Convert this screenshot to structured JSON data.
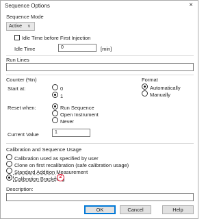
{
  "dialog": {
    "title": "Sequence Options",
    "close_glyph": "×"
  },
  "sequence_mode": {
    "heading": "Sequence Mode",
    "selected": "Active",
    "idle_checkbox_label": "Idle Time before First Injection",
    "idle_time_label": "Idle Time",
    "idle_time_value": "0",
    "idle_time_unit": "[min]"
  },
  "run_lines": {
    "heading": "Run Lines",
    "value": ""
  },
  "counter": {
    "heading": "Counter (%n)",
    "start_label": "Start at:",
    "start_options": [
      "0",
      "1"
    ],
    "start_selected": "1",
    "reset_label": "Reset when:",
    "reset_options": [
      "Run Sequence",
      "Open Instrument",
      "Never"
    ],
    "reset_selected": "Run Sequence",
    "current_value_label": "Current Value",
    "current_value": "1"
  },
  "format": {
    "heading": "Format",
    "options": [
      "Automatically",
      "Manually"
    ],
    "selected": "Automatically"
  },
  "calibration": {
    "heading": "Calibration and Sequence Usage",
    "options": [
      "Calibration used as specified by user",
      "Clone on first recalibration (safe calibration usage)",
      "Standard Addition Measurement",
      "Calibration Bracketing"
    ],
    "selected": "Calibration Bracketing",
    "annotation_badge": "2"
  },
  "description": {
    "label": "Description:",
    "value": ""
  },
  "buttons": {
    "ok": "OK",
    "cancel": "Cancel",
    "help": "Help"
  },
  "colors": {
    "accent": "#0078d7",
    "annotation": "#e0223a",
    "dropdown_bg": "#e8e8e8"
  }
}
